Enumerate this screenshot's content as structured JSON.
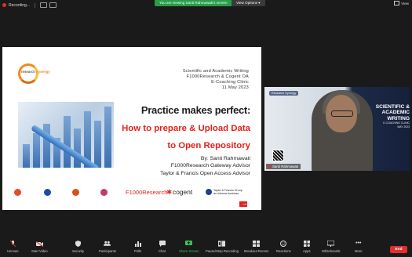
{
  "top": {
    "recording": "Recording...",
    "viewing": "You are viewing Santi Rahmawati's screen",
    "view_options": "View Options",
    "view": "View"
  },
  "slide": {
    "logo_text_1": "research",
    "logo_text_2": "synergy",
    "header": [
      "Scientific and Academic Writing",
      "F1000Research & Cogent OA",
      "E-Coaching Clinic",
      "11 May 2023"
    ],
    "title": "Practice makes perfect:",
    "subtitle_1": "How to prepare & Upload Data",
    "subtitle_2": "to Open Repository",
    "by": [
      "By: Santi Rahmawati",
      "F1000Research Gateway Advisor",
      "Taylor & Francis Open Access Advisor"
    ],
    "partner_logos": {
      "f1000": "F1000Research",
      "cogent": "cogent",
      "tf_1": "Taylor & Francis Group",
      "tf_2": "an informa business"
    }
  },
  "video": {
    "tag": "Research Synergy",
    "banner_1": "SCIENTIFIC &",
    "banner_2": "ACADEMIC",
    "banner_3": "WRITING",
    "banner_4": "E-COACHING CLINIC",
    "banner_5": "MAY 2023",
    "name": "Santi Rahmawati"
  },
  "toolbar": {
    "unmute": "Unmute",
    "start_video": "Start Video",
    "security": "Security",
    "participants": "Participants",
    "participants_count": "77",
    "polls": "Polls",
    "chat": "Chat",
    "share_screen": "Share Screen",
    "pause_recording": "Pause/Stop Recording",
    "breakout_rooms": "Breakout Rooms",
    "reactions": "Reactions",
    "apps": "Apps",
    "whiteboards": "Whiteboards",
    "more": "More",
    "end": "End"
  },
  "colors": {
    "accent_green": "#2a9c4a",
    "end_red": "#e02f2f",
    "slide_red": "#e2231a"
  }
}
